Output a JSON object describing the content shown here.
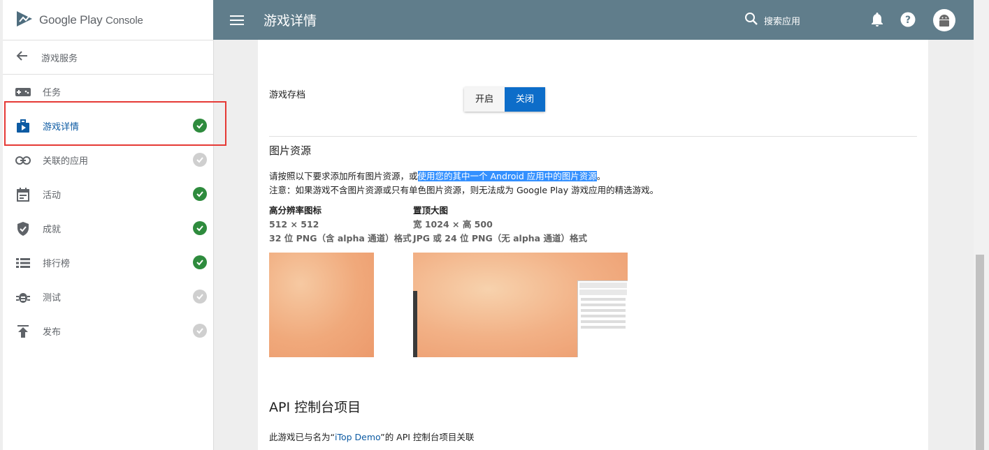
{
  "app": {
    "logo_main": "Google Play",
    "logo_sub": "Console"
  },
  "sidebar": {
    "back_label": "游戏服务",
    "items": [
      {
        "label": "任务",
        "status": "none",
        "icon": "gamepad-icon"
      },
      {
        "label": "游戏详情",
        "status": "done",
        "icon": "briefcase-play-icon",
        "active": true
      },
      {
        "label": "关联的应用",
        "status": "pending",
        "icon": "link-icon"
      },
      {
        "label": "活动",
        "status": "done",
        "icon": "calendar-icon"
      },
      {
        "label": "成就",
        "status": "done",
        "icon": "shield-check-icon"
      },
      {
        "label": "排行榜",
        "status": "done",
        "icon": "list-icon"
      },
      {
        "label": "测试",
        "status": "pending",
        "icon": "bug-icon"
      },
      {
        "label": "发布",
        "status": "pending",
        "icon": "publish-icon"
      }
    ]
  },
  "header": {
    "title": "游戏详情",
    "search_label": "搜索应用"
  },
  "saved_games": {
    "label": "游戏存档",
    "on_label": "开启",
    "off_label": "关闭",
    "selected": "off"
  },
  "graphics": {
    "title": "图片资源",
    "line1_prefix": "请按照以下要求添加所有图片资源，或",
    "line1_link": "使用您的其中一个 Android 应用中的图片资源",
    "line1_suffix": "。",
    "line2": "注意：如果游戏不含图片资源或只有单色图片资源，则无法成为 Google Play 游戏应用的精选游戏。",
    "icon": {
      "heading": "高分辨率图标",
      "size": "512 × 512",
      "format": "32 位 PNG（含 alpha 通道）格式"
    },
    "feature": {
      "heading": "置顶大图",
      "size": "宽 1024 × 高 500",
      "format": "JPG 或 24 位 PNG（无 alpha 通道）格式"
    }
  },
  "api": {
    "title": "API 控制台项目",
    "text_prefix": "此游戏已与名为“",
    "project_name": "iTop Demo",
    "text_suffix": "”的 API 控制台项目关联"
  },
  "colors": {
    "topbar": "#607d8b",
    "accent": "#0d6dc9",
    "done": "#2e8b3d",
    "pending": "#cfcfcf",
    "highlight": "#e53935"
  }
}
